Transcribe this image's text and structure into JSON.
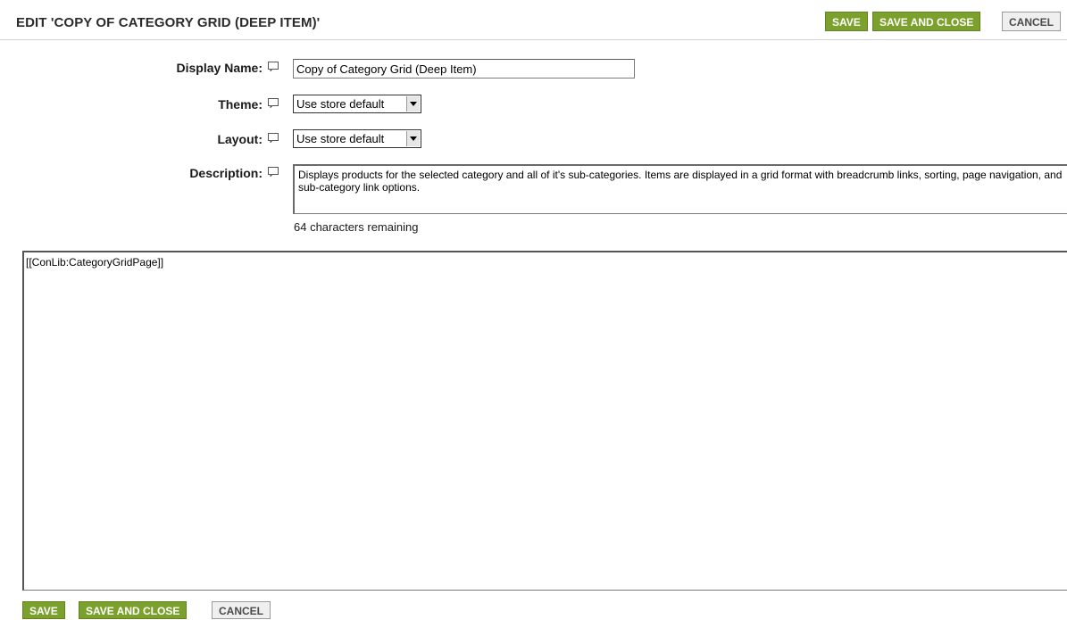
{
  "header": {
    "title": "EDIT 'COPY OF CATEGORY GRID (DEEP ITEM)'",
    "save_label": "SAVE",
    "save_close_label": "SAVE AND CLOSE",
    "cancel_label": "CANCEL"
  },
  "form": {
    "display_name": {
      "label": "Display Name:",
      "value": "Copy of Category Grid (Deep Item)"
    },
    "theme": {
      "label": "Theme:",
      "selected": "Use store default"
    },
    "layout": {
      "label": "Layout:",
      "selected": "Use store default"
    },
    "description": {
      "label": "Description:",
      "value": "Displays products for the selected category and all of it's sub-categories. Items are displayed in a grid format with breadcrumb links, sorting, page navigation, and sub-category link options.",
      "remaining": "64 characters remaining"
    }
  },
  "editor": {
    "content": "[[ConLib:CategoryGridPage]]"
  },
  "footer": {
    "save_label": "SAVE",
    "save_close_label": "SAVE AND CLOSE",
    "cancel_label": "CANCEL"
  },
  "colors": {
    "button_green": "#7ba12c",
    "button_gray": "#efefef"
  },
  "icons": {
    "help": "help-tooltip-icon"
  }
}
